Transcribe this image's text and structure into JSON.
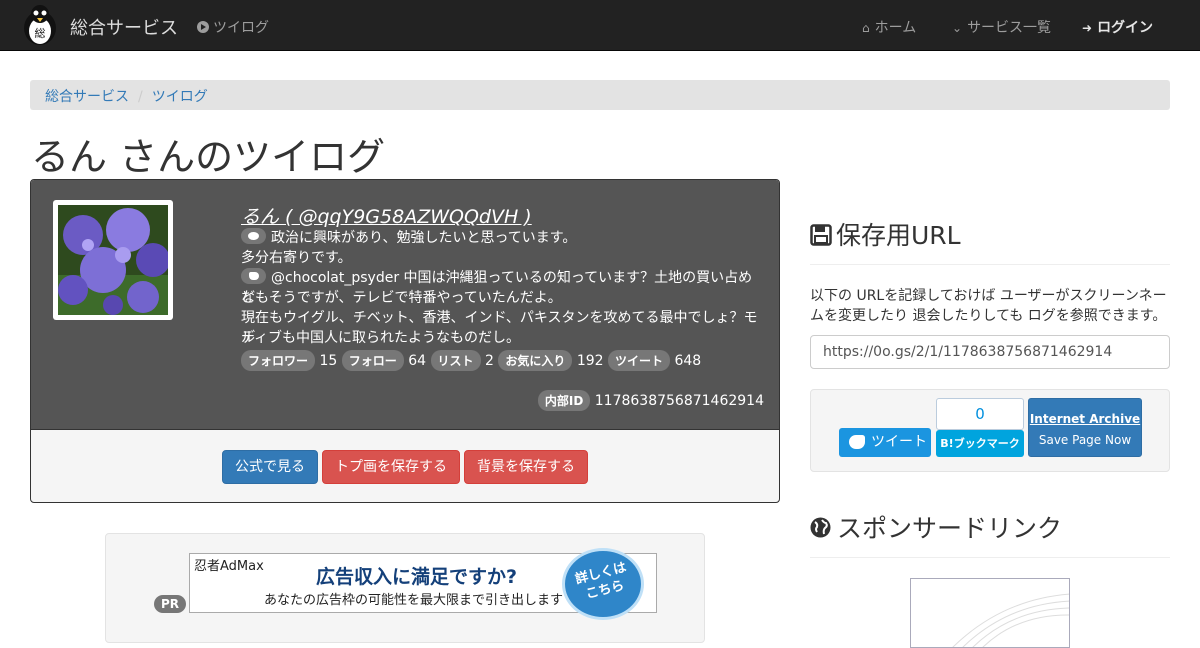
{
  "navbar": {
    "brand": "総合サービス",
    "tsuilog_link": "ツイログ",
    "home": "ホーム",
    "services": "サービス一覧",
    "login": "ログイン"
  },
  "breadcrumb": {
    "root": "総合サービス",
    "current": "ツイログ"
  },
  "page_title": "るん さんのツイログ",
  "profile": {
    "name_line": "るん ( @qqY9G58AZWQQdVH )",
    "bio": "政治に興味があり、勉強したいと思っています。",
    "bio2": "多分右寄りです。",
    "tweet_line1": "@chocolat_psyder 中国は沖縄狙っているの知っています？土地の買い占めな",
    "tweet_line2": "どもそうですが、テレビで特番やっていたんだよ。",
    "tweet_line3": "現在もウイグル、チベット、香港、インド、パキスタンを攻めてる最中でしょ？モル",
    "tweet_line4": "ディブも中国人に取られたようなものだし。",
    "stats": {
      "followers_label": "フォロワー",
      "followers": "15",
      "following_label": "フォロー",
      "following": "64",
      "lists_label": "リスト",
      "lists": "2",
      "favorites_label": "お気に入り",
      "favorites": "192",
      "tweets_label": "ツイート",
      "tweets": "648"
    },
    "internal_id_label": "内部ID",
    "internal_id": "1178638756871462914"
  },
  "actions": {
    "official": "公式で見る",
    "save_top": "トプ画を保存する",
    "save_bg": "背景を保存する"
  },
  "ad": {
    "pr": "PR",
    "logo": "忍者AdMax",
    "line1": "広告収入に満足ですか?",
    "line2": "あなたの広告枠の可能性を最大限まで引き出します",
    "circle1": "詳しくは",
    "circle2": "こちら"
  },
  "save_url": {
    "heading": "保存用URL",
    "help": "以下の URLを記録しておけば ユーザーがスクリーンネームを変更したり 退会したりしても ログを参照できます。",
    "url": "https://0o.gs/2/1/1178638756871462914"
  },
  "share": {
    "tweet": "ツイート",
    "hatena_count": "0",
    "hatena": "B!ブックマーク",
    "ia_title": "Internet Archive",
    "ia_sub": "Save Page Now"
  },
  "sponsor": {
    "heading": "スポンサードリンク"
  },
  "colors": {
    "navbar": "#222222",
    "primary": "#337ab7",
    "danger": "#d9534f",
    "profile_bg": "#555555"
  }
}
